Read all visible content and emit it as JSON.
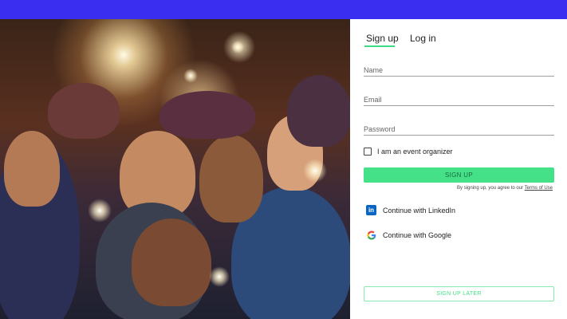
{
  "colors": {
    "top_bar": "#3a2ff0",
    "accent": "#45e189",
    "linkedin": "#0a66c2"
  },
  "hero": {
    "icon": "concert-crowd-photo"
  },
  "tabs": [
    {
      "label": "Sign up",
      "active": true
    },
    {
      "label": "Log in",
      "active": false
    }
  ],
  "form": {
    "name_placeholder": "Name",
    "email_placeholder": "Email",
    "password_placeholder": "Password",
    "organizer_label": "I am an event organizer",
    "organizer_checked": false,
    "signup_button": "SIGN UP",
    "terms_prefix": "By signing up, you agree to our ",
    "terms_link": "Terms of Use"
  },
  "social": {
    "linkedin_label": "Continue with LinkedIn",
    "linkedin_icon": "linkedin-icon",
    "google_label": "Continue with Google",
    "google_icon": "google-icon"
  },
  "footer": {
    "signup_later": "SIGN UP LATER"
  }
}
